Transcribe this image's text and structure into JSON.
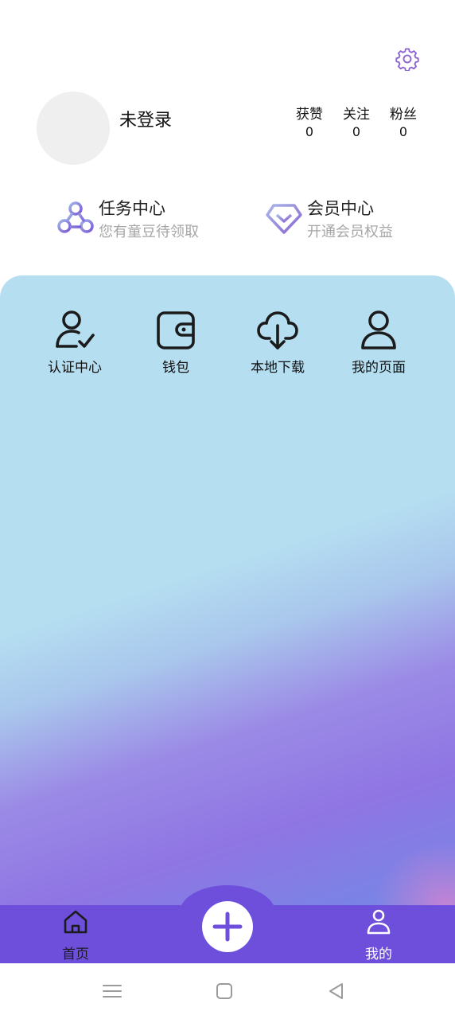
{
  "header": {
    "settings_icon": "gear-icon"
  },
  "profile": {
    "login_status": "未登录",
    "stats": [
      {
        "label": "获赞",
        "value": "0"
      },
      {
        "label": "关注",
        "value": "0"
      },
      {
        "label": "粉丝",
        "value": "0"
      }
    ]
  },
  "promos": {
    "task": {
      "title": "任务中心",
      "subtitle": "您有童豆待领取",
      "icon": "task-network-icon"
    },
    "vip": {
      "title": "会员中心",
      "subtitle": "开通会员权益",
      "icon": "diamond-icon"
    }
  },
  "features": [
    {
      "label": "认证中心",
      "icon": "user-verified-icon"
    },
    {
      "label": "钱包",
      "icon": "wallet-icon"
    },
    {
      "label": "本地下载",
      "icon": "cloud-download-icon"
    },
    {
      "label": "我的页面",
      "icon": "user-icon"
    }
  ],
  "tabbar": {
    "home_label": "首页",
    "mine_label": "我的",
    "add_icon": "plus-icon",
    "active_tab": "我的",
    "bar_color": "#6d4fdc"
  },
  "system_nav": {
    "icons": [
      "menu-icon",
      "home-square-icon",
      "back-triangle-icon"
    ]
  },
  "colors": {
    "accent": "#6d4fdc",
    "panel_top": "#b5def1",
    "panel_bottom": "#8f75e3",
    "settings_icon": "#8a5fd0"
  }
}
